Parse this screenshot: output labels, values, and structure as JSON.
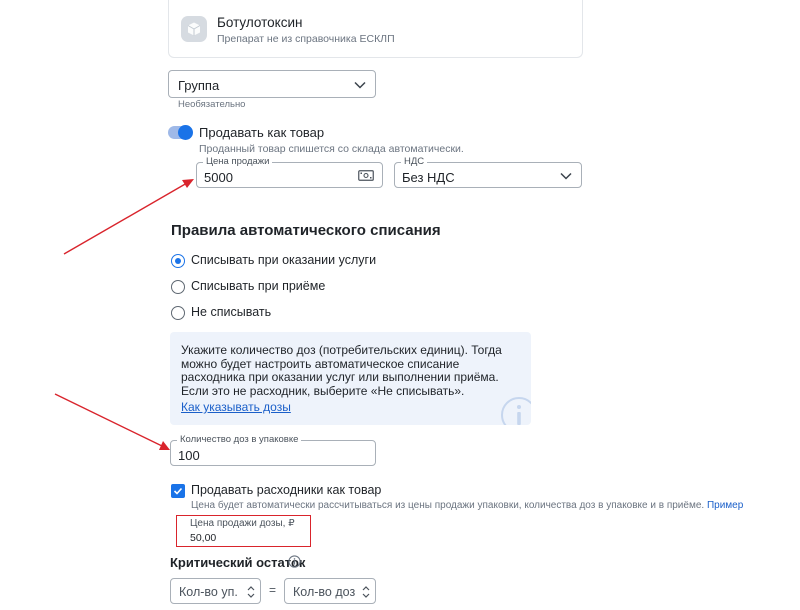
{
  "product": {
    "name": "Ботулотоксин",
    "subtitle": "Препарат не из справочника ЕСКЛП",
    "icon": "box-icon"
  },
  "group": {
    "value": "Группа",
    "hint": "Необязательно"
  },
  "sell_toggle": {
    "on": true,
    "label": "Продавать как товар",
    "sub": "Проданный товар спишется со склада автоматически."
  },
  "price": {
    "label": "Цена продажи",
    "value": "5000",
    "icon": "money-icon"
  },
  "vat": {
    "label": "НДС",
    "value": "Без НДС"
  },
  "rules": {
    "title": "Правила автоматического списания",
    "options": [
      {
        "label": "Списывать при оказании услуги",
        "checked": true
      },
      {
        "label": "Списывать при приёме",
        "checked": false
      },
      {
        "label": "Не списывать",
        "checked": false
      }
    ]
  },
  "info": {
    "text": "Укажите количество доз (потребительских единиц). Тогда можно будет настроить автоматическое списание расходника при оказании услуг или выполнении приёма. Если это не расходник, выберите «Не списывать».",
    "link": "Как указывать дозы",
    "icon": "info-icon"
  },
  "doses": {
    "label": "Количество доз в упаковке",
    "value": "100"
  },
  "consumables": {
    "checked": true,
    "label": "Продавать расходники как товар",
    "sub": "Цена будет автоматически рассчитываться из цены продажи упаковки, количества доз в упаковке и в приёме.",
    "sub_link": "Пример"
  },
  "dose_price": {
    "label": "Цена продажи дозы, ₽",
    "value": "50,00"
  },
  "critical": {
    "title": "Критический остаток",
    "packs_placeholder": "Кол-во уп.",
    "equals": "=",
    "doses_placeholder": "Кол-во доз"
  },
  "colors": {
    "accent": "#1a73e8",
    "annotation_red": "#d9242c",
    "info_bg": "#eef3fb"
  }
}
